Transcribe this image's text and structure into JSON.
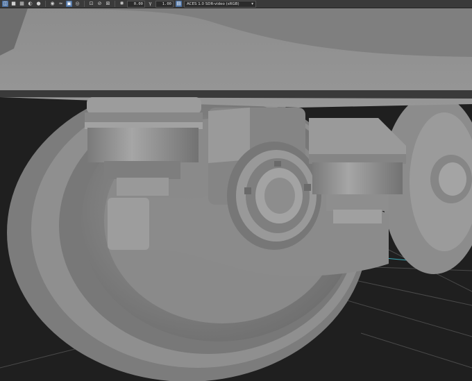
{
  "toolbar": {
    "icons": [
      "wireframe-shade-icon",
      "smooth-shade-icon",
      "textured-icon",
      "lighting-icon",
      "shadows-icon",
      "ambient-occlusion-icon",
      "motion-blur-icon",
      "anti-alias-icon",
      "depth-of-field-icon",
      "isolate-icon",
      "xray-icon",
      "backface-icon",
      "exposure-icon",
      "gamma-icon",
      "color-management-icon"
    ],
    "exposure_value": "0.00",
    "gamma_value": "1.00",
    "color_space": "ACES 1.0 SDR-video (sRGB)"
  }
}
